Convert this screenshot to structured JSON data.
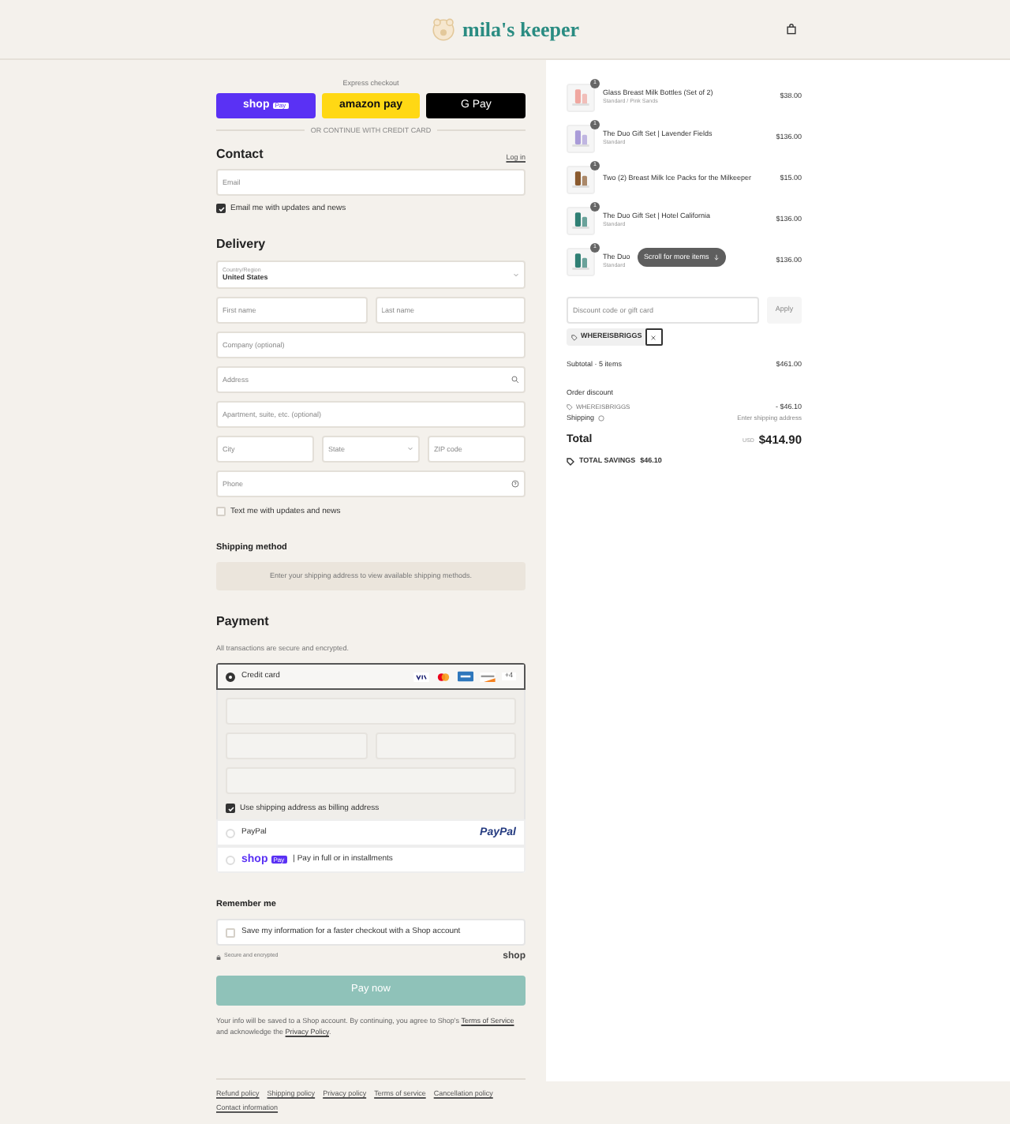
{
  "header": {
    "logo": "mila's keeper"
  },
  "express": {
    "label": "Express checkout",
    "buttons": [
      {
        "kind": "shop",
        "label": "shop",
        "badge": "Pay"
      },
      {
        "kind": "amazon",
        "label": "amazon pay"
      },
      {
        "kind": "google",
        "label": "G Pay"
      }
    ],
    "divider": "OR CONTINUE WITH CREDIT CARD"
  },
  "contact": {
    "title": "Contact",
    "link": "Log in",
    "email": {
      "placeholder": "Email"
    },
    "newsletter": {
      "label": "Email me with updates and news",
      "checked": true
    }
  },
  "delivery": {
    "title": "Delivery",
    "rows": [
      [
        {
          "kind": "select",
          "label": "Country/Region",
          "value": "United States"
        }
      ],
      [
        {
          "kind": "text",
          "placeholder": "First name"
        },
        {
          "kind": "text",
          "placeholder": "Last name"
        }
      ],
      [
        {
          "kind": "text",
          "placeholder": "Company (optional)"
        }
      ],
      [
        {
          "kind": "search",
          "placeholder": "Address"
        }
      ],
      [
        {
          "kind": "text",
          "placeholder": "Apartment, suite, etc. (optional)"
        }
      ],
      [
        {
          "kind": "text",
          "placeholder": "City"
        },
        {
          "kind": "select",
          "placeholder": "State"
        },
        {
          "kind": "text",
          "placeholder": "ZIP code"
        }
      ],
      [
        {
          "kind": "help",
          "placeholder": "Phone"
        }
      ]
    ],
    "sms": {
      "label": "Text me with updates and news",
      "checked": false
    }
  },
  "shipping_method": {
    "title": "Shipping method",
    "message": "Enter your shipping address to view available shipping methods."
  },
  "payment": {
    "title": "Payment",
    "subtitle": "All transactions are secure and encrypted.",
    "methods": [
      {
        "kind": "card",
        "label": "Credit card",
        "selected": true,
        "more": "+4",
        "billing": {
          "label": "Use shipping address as billing address",
          "checked": true
        }
      },
      {
        "kind": "paypal",
        "label": "PayPal",
        "logo": "PayPal",
        "selected": false
      },
      {
        "kind": "shoppay",
        "logo": "shop",
        "badge": "Pay",
        "label": "| Pay in full or in installments",
        "selected": false
      }
    ]
  },
  "remember": {
    "title": "Remember me",
    "label": "Save my information for a faster checkout with a Shop account",
    "checked": false
  },
  "secure": "Secure and encrypted",
  "shop_logo": "shop",
  "pay_button": "Pay now",
  "disclaimer": [
    {
      "kind": "text",
      "text": "Your info will be saved to a Shop account. By continuing, you agree to Shop's "
    },
    {
      "kind": "link",
      "text": "Terms of Service"
    },
    {
      "kind": "text",
      "text": " and acknowledge the "
    },
    {
      "kind": "link",
      "text": "Privacy Policy"
    },
    {
      "kind": "text",
      "text": "."
    }
  ],
  "footer_links": [
    "Refund policy",
    "Shipping policy",
    "Privacy policy",
    "Terms of service",
    "Cancellation policy",
    "Contact information"
  ],
  "summary": {
    "items": [
      {
        "name": "Glass Breast Milk Bottles (Set of 2)",
        "variant": "Standard / Pink Sands",
        "price": "$38.00",
        "quantity": "1"
      },
      {
        "name": "The Duo Gift Set | Lavender Fields",
        "variant": "Standard",
        "price": "$136.00",
        "quantity": "1"
      },
      {
        "name": "Two (2) Breast Milk Ice Packs for the Milkeeper",
        "price": "$15.00",
        "quantity": "1"
      },
      {
        "name": "The Duo Gift Set | Hotel California",
        "variant": "Standard",
        "price": "$136.00",
        "quantity": "1"
      },
      {
        "name": "The Duo",
        "variant": "Standard",
        "price": "$136.00",
        "quantity": "1"
      }
    ],
    "scroll_hint": "Scroll for more items",
    "discount": {
      "placeholder": "Discount code or gift card",
      "button": "Apply"
    },
    "tag": "WHEREISBRIGGS",
    "subtotal": {
      "label": "Subtotal · 5 items",
      "value": "$461.00"
    },
    "order_discount": {
      "label": "Order discount",
      "code": "WHEREISBRIGGS",
      "value": "- $46.10"
    },
    "shipping": {
      "label": "Shipping",
      "value": "Enter shipping address"
    },
    "total": {
      "label": "Total",
      "currency": "USD",
      "value": "$414.90"
    },
    "savings": {
      "label": "TOTAL SAVINGS",
      "value": "$46.10"
    }
  }
}
